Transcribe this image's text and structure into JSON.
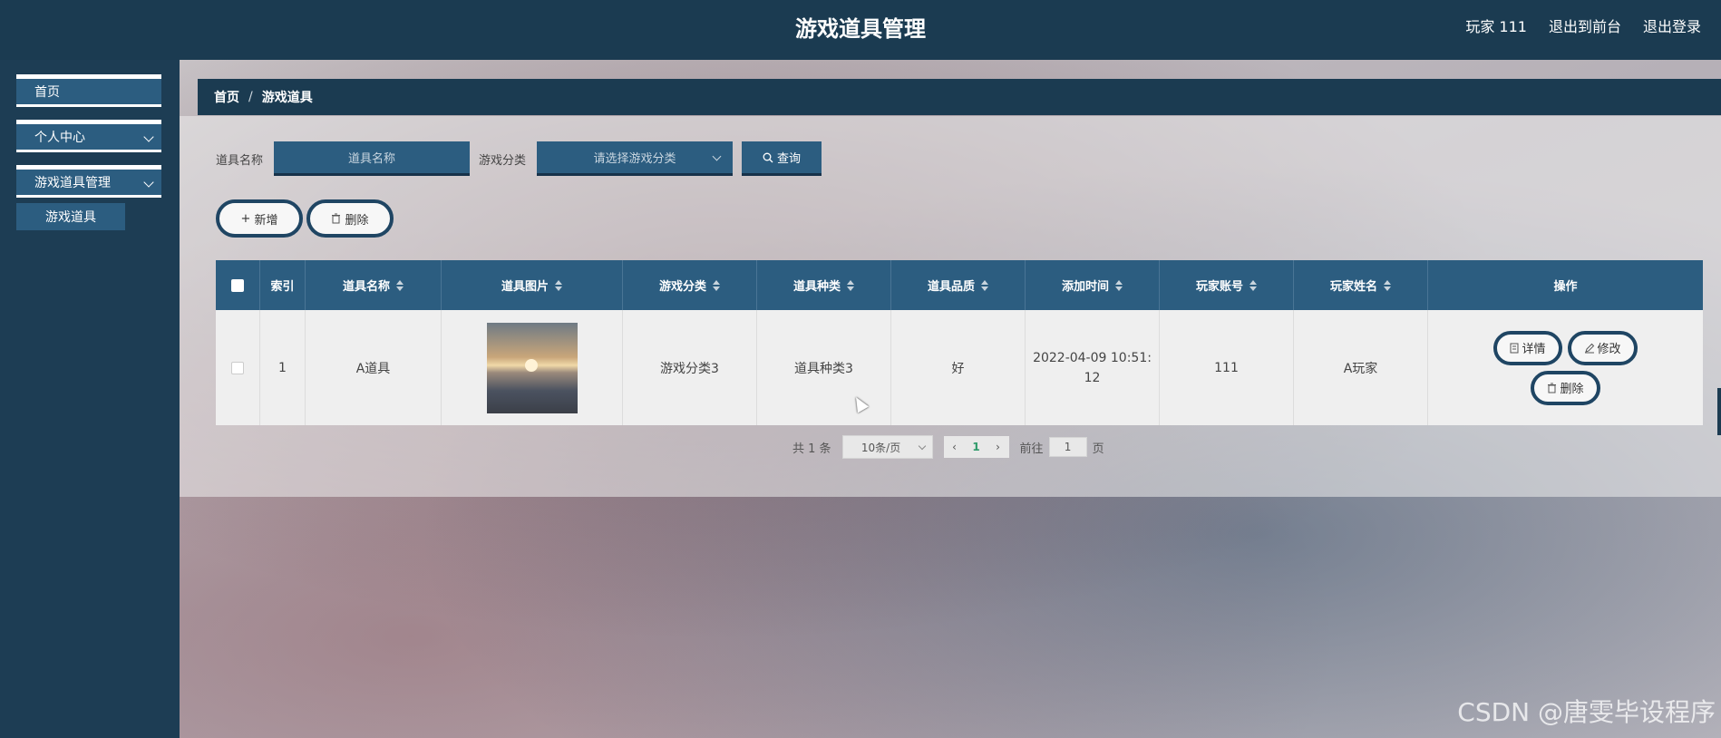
{
  "header": {
    "title": "游戏道具管理",
    "user": "玩家 111",
    "to_front": "退出到前台",
    "logout": "退出登录"
  },
  "sidebar": {
    "items": [
      {
        "label": "首页"
      },
      {
        "label": "个人中心"
      },
      {
        "label": "游戏道具管理"
      }
    ],
    "sub_item": "游戏道具"
  },
  "breadcrumb": {
    "home": "首页",
    "sep": "/",
    "current": "游戏道具"
  },
  "search": {
    "name_label": "道具名称",
    "name_placeholder": "道具名称",
    "category_label": "游戏分类",
    "category_placeholder": "请选择游戏分类",
    "query_label": "查询"
  },
  "actions": {
    "add": "新增",
    "delete": "删除"
  },
  "table": {
    "headers": [
      "索引",
      "道具名称",
      "道具图片",
      "游戏分类",
      "道具种类",
      "道具品质",
      "添加时间",
      "玩家账号",
      "玩家姓名",
      "操作"
    ],
    "rows": [
      {
        "index": "1",
        "name": "A道具",
        "category": "游戏分类3",
        "kind": "道具种类3",
        "quality": "好",
        "time_line1": "2022-04-09 10:51:",
        "time_line2": "12",
        "account": "111",
        "player": "A玩家",
        "op_detail": "详情",
        "op_edit": "修改",
        "op_delete": "删除"
      }
    ]
  },
  "pagination": {
    "total": "共 1 条",
    "page_size": "10条/页",
    "current": "1",
    "goto_label": "前往",
    "goto_value": "1",
    "page_unit": "页"
  },
  "watermark": "CSDN @唐雯毕设程序"
}
